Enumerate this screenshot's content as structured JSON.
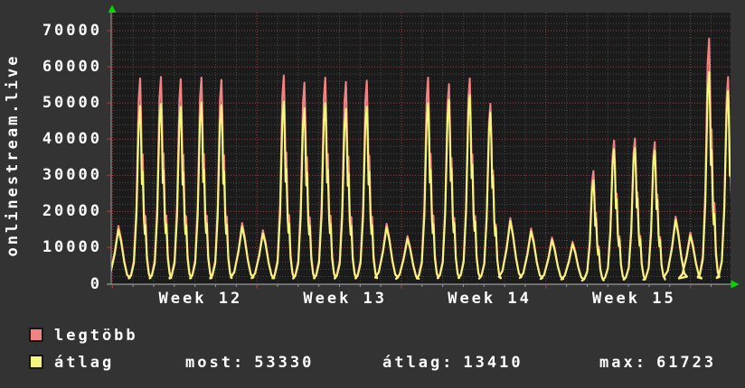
{
  "y_axis_label": "onlinestream.live",
  "y_ticks": [
    {
      "value": 0,
      "label": "0"
    },
    {
      "value": 10000,
      "label": "10000"
    },
    {
      "value": 20000,
      "label": "20000"
    },
    {
      "value": 30000,
      "label": "30000"
    },
    {
      "value": 40000,
      "label": "40000"
    },
    {
      "value": 50000,
      "label": "50000"
    },
    {
      "value": 60000,
      "label": "60000"
    },
    {
      "value": 70000,
      "label": "70000"
    }
  ],
  "legend": {
    "items": [
      {
        "label": "legtöbb",
        "color": "#f28383"
      },
      {
        "label": "átlag",
        "color": "#f6f67c"
      }
    ]
  },
  "stats": [
    {
      "label": "most:",
      "value": "53330"
    },
    {
      "label": "átlag:",
      "value": "13410"
    },
    {
      "label": "max:",
      "value": "61723"
    }
  ],
  "colors": {
    "outer_bg": "#333333",
    "plot_bg": "#1b1b1b",
    "grid_minor": "#4a4a4a",
    "grid_major": "#a04040",
    "axis": "#9a9a9a",
    "arrow": "#00d800",
    "text": "#ffffff",
    "series_max": "#f28383",
    "series_avg": "#f6f67c"
  },
  "chart_data": {
    "type": "line",
    "title": "onlinestream.live",
    "ylabel": "onlinestream.live",
    "ylim": [
      0,
      75000
    ],
    "x_range_days": 30,
    "grid": {
      "y_minor_step": 2000,
      "y_major_step": 10000,
      "x_minor_step_days": 1,
      "x_major_step_days": 7,
      "first_gridline_day": 0.057
    },
    "x_tick_labels": [
      {
        "label": "Week 12",
        "center_day": 4.33
      },
      {
        "label": "Week 13",
        "center_day": 11.33
      },
      {
        "label": "Week 14",
        "center_day": 18.33
      },
      {
        "label": "Week 15",
        "center_day": 25.33
      }
    ],
    "legend_position": "bottom-left",
    "series": [
      {
        "name": "legtöbb",
        "role": "max",
        "color": "#f28383"
      },
      {
        "name": "átlag",
        "role": "avg",
        "color": "#f6f67c"
      }
    ],
    "days": [
      {
        "t": 0.35,
        "max": 16000,
        "avg": 15000,
        "shape": "small"
      },
      {
        "t": 1.4,
        "max": 56800,
        "avg": 49200,
        "shape": "tall"
      },
      {
        "t": 2.41,
        "max": 57200,
        "avg": 49800,
        "shape": "tall"
      },
      {
        "t": 3.37,
        "max": 56600,
        "avg": 49000,
        "shape": "tall"
      },
      {
        "t": 4.37,
        "max": 57000,
        "avg": 50200,
        "shape": "tall"
      },
      {
        "t": 5.34,
        "max": 56400,
        "avg": 49400,
        "shape": "tall"
      },
      {
        "t": 6.34,
        "max": 16800,
        "avg": 15900,
        "shape": "small"
      },
      {
        "t": 7.35,
        "max": 14800,
        "avg": 14000,
        "shape": "small"
      },
      {
        "t": 8.36,
        "max": 57600,
        "avg": 50400,
        "shape": "tall"
      },
      {
        "t": 9.36,
        "max": 55600,
        "avg": 48600,
        "shape": "tall"
      },
      {
        "t": 10.37,
        "max": 57000,
        "avg": 50000,
        "shape": "tall"
      },
      {
        "t": 11.37,
        "max": 55800,
        "avg": 48400,
        "shape": "tall"
      },
      {
        "t": 12.38,
        "max": 56200,
        "avg": 49000,
        "shape": "tall"
      },
      {
        "t": 13.34,
        "max": 16600,
        "avg": 15700,
        "shape": "small"
      },
      {
        "t": 14.35,
        "max": 13200,
        "avg": 12500,
        "shape": "small"
      },
      {
        "t": 15.35,
        "max": 57000,
        "avg": 50000,
        "shape": "tall"
      },
      {
        "t": 16.36,
        "max": 55200,
        "avg": 50800,
        "shape": "tall"
      },
      {
        "t": 17.37,
        "max": 56800,
        "avg": 52200,
        "shape": "tall"
      },
      {
        "t": 18.37,
        "max": 49800,
        "avg": 47400,
        "shape": "tall"
      },
      {
        "t": 19.33,
        "max": 18200,
        "avg": 17300,
        "shape": "small"
      },
      {
        "t": 20.34,
        "max": 15300,
        "avg": 14500,
        "shape": "small"
      },
      {
        "t": 21.35,
        "max": 12800,
        "avg": 12100,
        "shape": "small"
      },
      {
        "t": 22.35,
        "max": 11600,
        "avg": 11000,
        "shape": "small"
      },
      {
        "t": 23.36,
        "max": 31200,
        "avg": 28600,
        "shape": "tall"
      },
      {
        "t": 24.36,
        "max": 39600,
        "avg": 37200,
        "shape": "tall"
      },
      {
        "t": 25.37,
        "max": 40200,
        "avg": 37600,
        "shape": "tall"
      },
      {
        "t": 26.33,
        "max": 39200,
        "avg": 36800,
        "shape": "tall"
      },
      {
        "t": 27.34,
        "max": 18600,
        "avg": 17700,
        "shape": "small"
      },
      {
        "t": 28.05,
        "max": 14200,
        "avg": 13400,
        "shape": "small"
      },
      {
        "t": 28.96,
        "max": 67800,
        "avg": 58600,
        "shape": "tall"
      },
      {
        "t": 29.88,
        "max": 57200,
        "avg": 53330,
        "shape": "tall"
      }
    ]
  }
}
